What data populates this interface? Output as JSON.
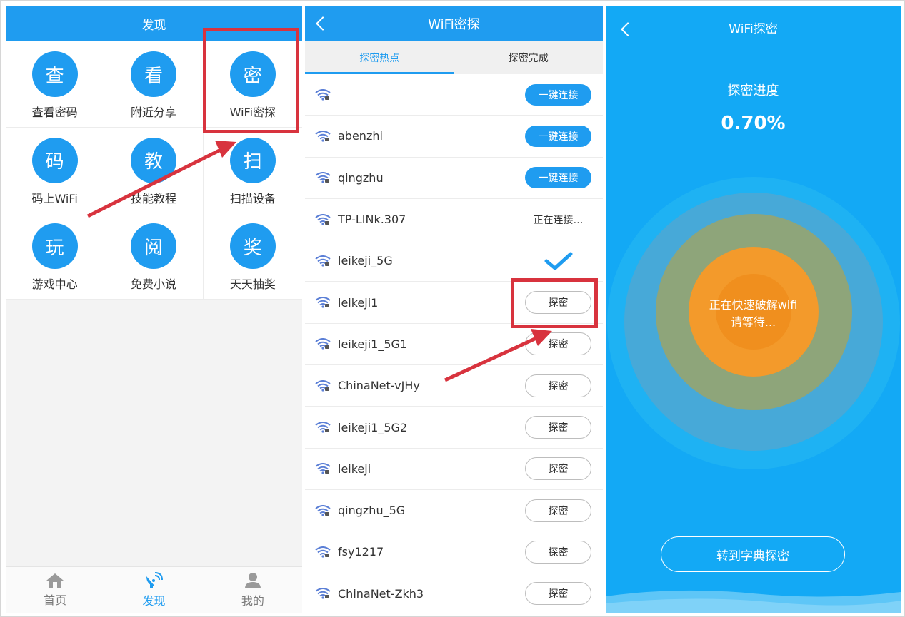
{
  "colors": {
    "primary": "#1f9cf0",
    "progress_bg": "#13a9f5",
    "highlight": "#d8333e",
    "core": "#f08f1e"
  },
  "panel1": {
    "header": "发现",
    "grid": [
      {
        "glyph": "查",
        "label": "查看密码"
      },
      {
        "glyph": "看",
        "label": "附近分享"
      },
      {
        "glyph": "密",
        "label": "WiFi密探"
      },
      {
        "glyph": "码",
        "label": "码上WiFi"
      },
      {
        "glyph": "教",
        "label": "技能教程"
      },
      {
        "glyph": "扫",
        "label": "扫描设备"
      },
      {
        "glyph": "玩",
        "label": "游戏中心"
      },
      {
        "glyph": "阅",
        "label": "免费小说"
      },
      {
        "glyph": "奖",
        "label": "天天抽奖"
      }
    ],
    "nav": [
      {
        "label": "首页",
        "icon": "home-icon"
      },
      {
        "label": "发现",
        "icon": "radar-icon"
      },
      {
        "label": "我的",
        "icon": "user-icon"
      }
    ]
  },
  "panel2": {
    "header": "WiFi密探",
    "tabs": [
      "探密热点",
      "探密完成"
    ],
    "rows": [
      {
        "ssid": "",
        "action": "connect",
        "label": "一键连接"
      },
      {
        "ssid": "abenzhi",
        "action": "connect",
        "label": "一键连接"
      },
      {
        "ssid": "qingzhu",
        "action": "connect",
        "label": "一键连接"
      },
      {
        "ssid": "TP-LINk.307",
        "action": "status",
        "label": "正在连接…"
      },
      {
        "ssid": "leikeji_5G",
        "action": "check",
        "label": ""
      },
      {
        "ssid": "leikeji1",
        "action": "probe",
        "label": "探密"
      },
      {
        "ssid": "leikeji1_5G1",
        "action": "probe",
        "label": "探密"
      },
      {
        "ssid": "ChinaNet-vJHy",
        "action": "probe",
        "label": "探密"
      },
      {
        "ssid": "leikeji1_5G2",
        "action": "probe",
        "label": "探密"
      },
      {
        "ssid": "leikeji",
        "action": "probe",
        "label": "探密"
      },
      {
        "ssid": "qingzhu_5G",
        "action": "probe",
        "label": "探密"
      },
      {
        "ssid": "fsy1217",
        "action": "probe",
        "label": "探密"
      },
      {
        "ssid": "ChinaNet-Zkh3",
        "action": "probe",
        "label": "探密"
      }
    ]
  },
  "panel3": {
    "title": "WiFi探密",
    "progress_label": "探密进度",
    "progress_value": "0.70%",
    "status_line1": "正在快速破解wifi",
    "status_line2": "请等待...",
    "dict_button": "转到字典探密"
  }
}
